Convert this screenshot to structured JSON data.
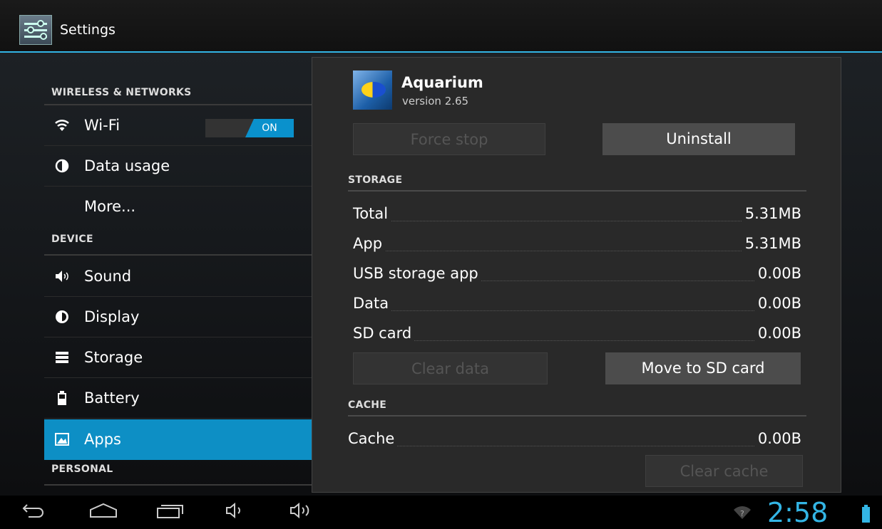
{
  "topbar": {
    "title": "Settings"
  },
  "left": {
    "categories": {
      "wireless": "WIRELESS & NETWORKS",
      "device": "DEVICE",
      "personal": "PERSONAL"
    },
    "items": {
      "wifi": {
        "label": "Wi-Fi",
        "icon": "wifi-icon",
        "toggle": "ON"
      },
      "data_usage": {
        "label": "Data usage",
        "icon": "pie-icon"
      },
      "more": {
        "label": "More..."
      },
      "sound": {
        "label": "Sound",
        "icon": "speaker-icon"
      },
      "display": {
        "label": "Display",
        "icon": "brightness-icon"
      },
      "storage": {
        "label": "Storage",
        "icon": "storage-icon"
      },
      "battery": {
        "label": "Battery",
        "icon": "battery-icon"
      },
      "apps": {
        "label": "Apps",
        "icon": "apps-icon",
        "selected": true
      }
    }
  },
  "app": {
    "name": "Aquarium",
    "version": "version 2.65",
    "buttons": {
      "force_stop": "Force stop",
      "uninstall": "Uninstall",
      "clear_data": "Clear data",
      "move_sd": "Move to SD card",
      "clear_cache": "Clear cache"
    },
    "storage_header": "STORAGE",
    "storage": [
      {
        "label": "Total",
        "value": "5.31MB"
      },
      {
        "label": "App",
        "value": "5.31MB"
      },
      {
        "label": "USB storage app",
        "value": "0.00B"
      },
      {
        "label": "Data",
        "value": "0.00B"
      },
      {
        "label": "SD card",
        "value": "0.00B"
      }
    ],
    "cache_header": "CACHE",
    "cache": {
      "label": "Cache",
      "value": "0.00B"
    }
  },
  "status": {
    "time": "2:58"
  },
  "colors": {
    "accent": "#33b5e5",
    "selected": "#0d8fc5"
  }
}
